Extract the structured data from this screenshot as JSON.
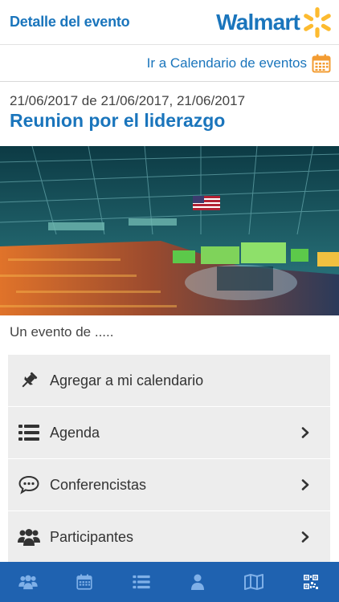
{
  "header": {
    "title": "Detalle del evento",
    "logo_text": "Walmart",
    "brand_color": "#1a75bc",
    "spark_color": "#fdbb30"
  },
  "calendar_link": {
    "label": "Ir a Calendario de eventos",
    "icon": "calendar-icon"
  },
  "event": {
    "date": "21/06/2017 de 21/06/2017, 21/06/2017",
    "title": "Reunion por el liderazgo",
    "image": "arena-stage-photo",
    "organizer_text": "Un evento de ....."
  },
  "menu": {
    "items": [
      {
        "label": "Agregar a mi calendario",
        "icon": "pin-icon",
        "has_chevron": false
      },
      {
        "label": "Agenda",
        "icon": "list-icon",
        "has_chevron": true
      },
      {
        "label": "Conferencistas",
        "icon": "chat-icon",
        "has_chevron": true
      },
      {
        "label": "Participantes",
        "icon": "group-icon",
        "has_chevron": true
      }
    ]
  },
  "bottom_nav": {
    "background": "#1f62b0",
    "items": [
      {
        "icon": "group-icon"
      },
      {
        "icon": "calendar-icon"
      },
      {
        "icon": "list-icon"
      },
      {
        "icon": "person-icon"
      },
      {
        "icon": "map-icon"
      },
      {
        "icon": "qr-code-icon"
      }
    ]
  }
}
